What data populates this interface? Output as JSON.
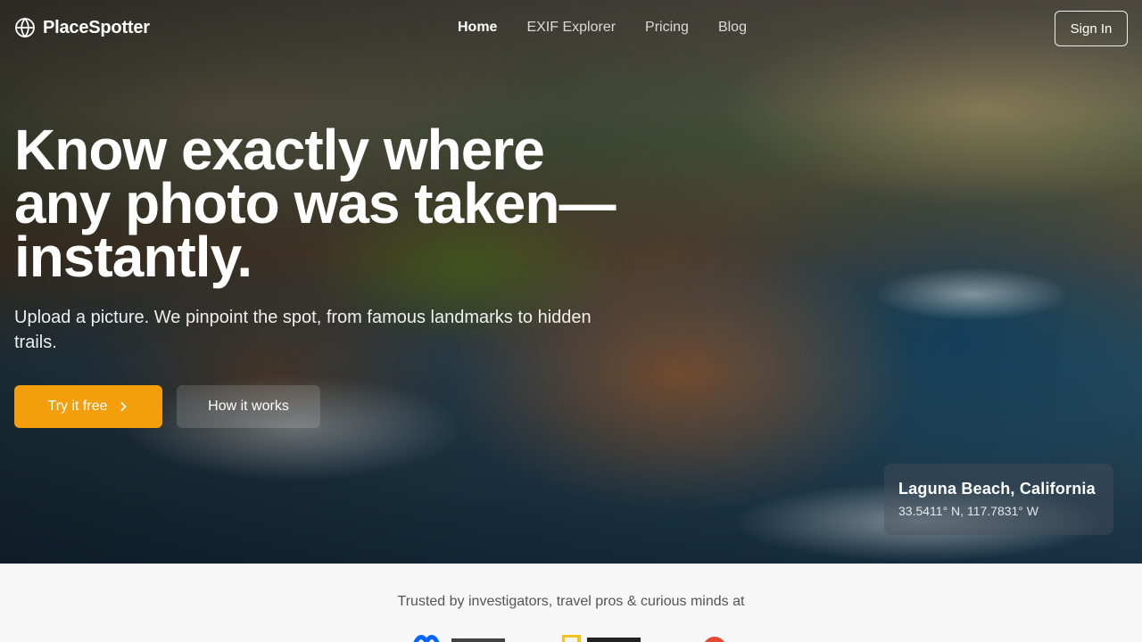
{
  "nav": {
    "brand": "PlaceSpotter",
    "links": [
      {
        "label": "Home",
        "active": true
      },
      {
        "label": "EXIF Explorer",
        "active": false
      },
      {
        "label": "Pricing",
        "active": false
      },
      {
        "label": "Blog",
        "active": false
      }
    ],
    "signin_label": "Sign In"
  },
  "hero": {
    "headline_lines": [
      "Know exactly where",
      "any photo was taken—",
      "instantly."
    ],
    "subhead": "Upload a picture. We pinpoint the spot, from famous landmarks to hidden trails.",
    "primary_cta": "Try it free",
    "secondary_cta": "How it works"
  },
  "location_card": {
    "title": "Laguna Beach, California",
    "coords": "33.5411° N, 117.7831° W"
  },
  "trusted": {
    "text": "Trusted by investigators, travel pros & curious minds at",
    "logos": [
      "meta-logo",
      "national-geographic-logo",
      "red-circle-logo"
    ]
  },
  "colors": {
    "accent": "#f59e0b",
    "hero_text": "#ffffff",
    "section_bg": "#f7f7f7"
  },
  "icons": {
    "logo": "globe-icon",
    "cta_arrow": "chevron-right-icon"
  }
}
